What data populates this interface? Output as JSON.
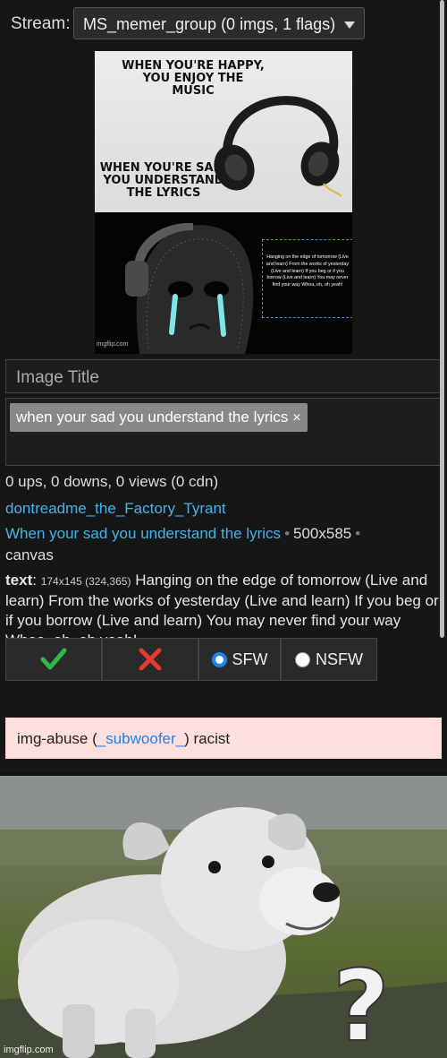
{
  "stream": {
    "label": "Stream:",
    "selected": "MS_memer_group (0 imgs, 1 flags)"
  },
  "meme": {
    "top_text": "WHEN YOU'RE HAPPY, YOU ENJOY THE MUSIC",
    "bottom_text": "WHEN YOU'RE SAD, YOU UNDERSTAND THE LYRICS",
    "lyrics_box": "Hanging on the edge of tomorrow (Live and learn) From the works of yesterday (Live and learn) If you beg or if you borrow (Live and learn) You may never find your way Whoa, oh, oh yeah!",
    "watermark": "imgflip.com"
  },
  "form": {
    "title_placeholder": "Image Title",
    "tag": "when your sad you understand the lyrics",
    "tag_remove": "×"
  },
  "info": {
    "stats": "0 ups, 0 downs, 0 views (0 cdn)",
    "user": "dontreadme_the_Factory_Tyrant",
    "title_link": "When your sad you understand the lyrics",
    "separator": "•",
    "dimensions": "500x585",
    "canvas": "canvas",
    "text_key": "text",
    "text_colon": ":",
    "text_coords": "174x145 (324,365)",
    "text_value": "Hanging on the edge of tomorrow (Live and learn) From the works of yesterday (Live and learn) If you beg or if you borrow (Live and learn) You may never find your way Whoa, oh, oh yeah!"
  },
  "actions": {
    "approve_icon": "check-icon",
    "reject_icon": "cross-icon",
    "sfw_label": "SFW",
    "nsfw_label": "NSFW",
    "selected": "SFW"
  },
  "flag": {
    "prefix": "img-abuse (",
    "user": "_subwoofer_",
    "suffix": ") racist"
  },
  "footer": {
    "watermark": "imgflip.com"
  },
  "colors": {
    "link": "#43b4e8",
    "approve": "#2fb84a",
    "reject": "#e53935",
    "flag_bg": "#ffdede",
    "radio_selected": "#1f82e6"
  }
}
